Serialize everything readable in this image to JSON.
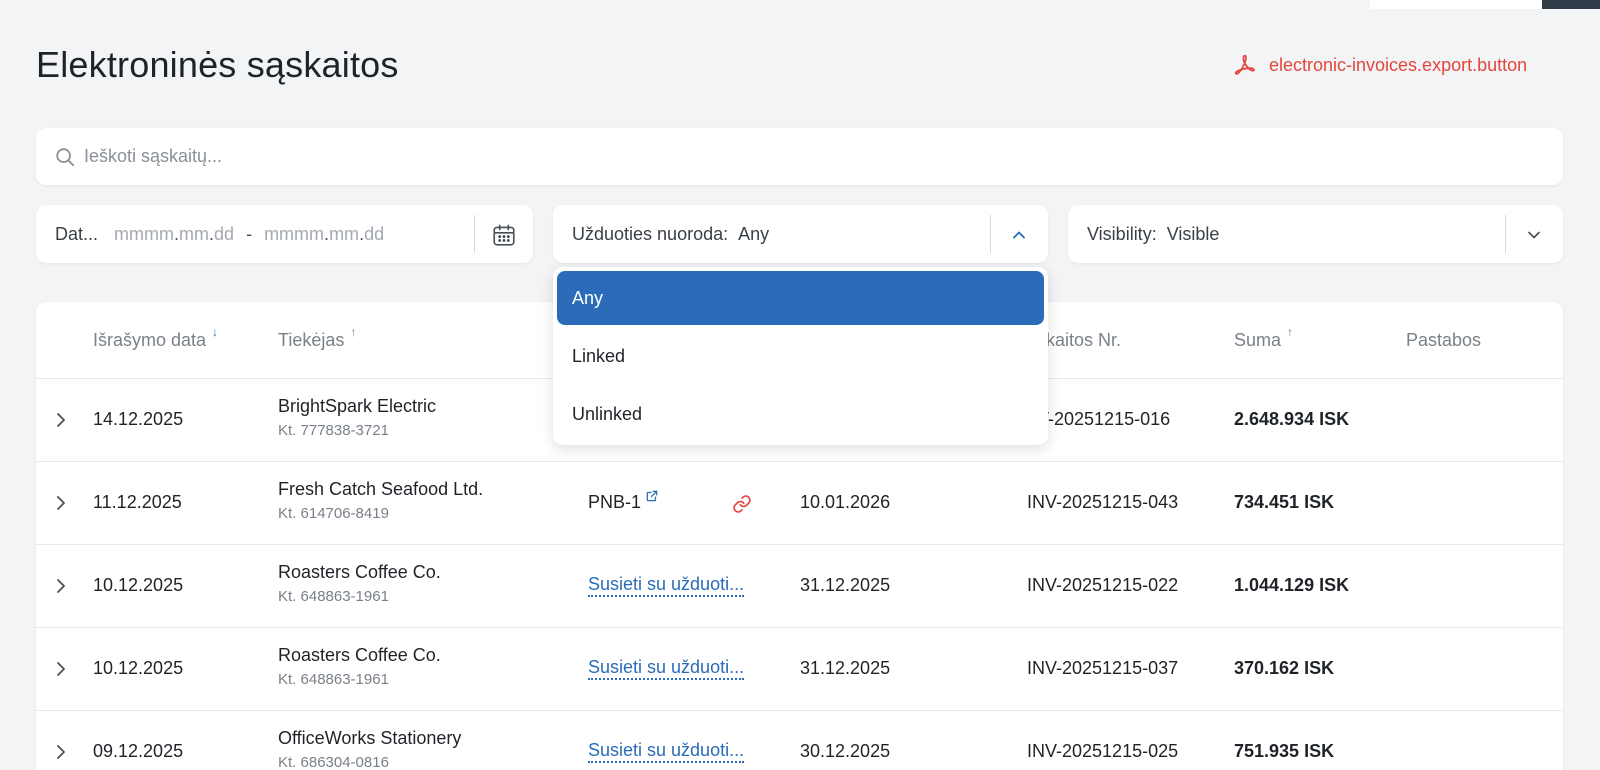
{
  "page": {
    "title": "Elektroninės sąskaitos",
    "export_label": "electronic-invoices.export.button"
  },
  "search": {
    "placeholder": "Ieškoti sąskaitų..."
  },
  "filters": {
    "date": {
      "label": "Dat...",
      "from_placeholder_parts": [
        "mmmm",
        "mm",
        "dd"
      ],
      "to_placeholder_parts": [
        "mmmm",
        "mm",
        "dd"
      ],
      "separator": "-"
    },
    "task_link": {
      "label": "Užduoties nuoroda:",
      "value": "Any",
      "open": true,
      "options": [
        "Any",
        "Linked",
        "Unlinked"
      ],
      "selected_index": 0
    },
    "visibility": {
      "label": "Visibility:",
      "value": "Visible"
    }
  },
  "table": {
    "columns": {
      "issue_date": "Išrašymo data",
      "supplier": "Tiekėjas",
      "invoice_no": "skaitos Nr.",
      "amount": "Suma",
      "notes": "Pastabos"
    },
    "rows": [
      {
        "issue_date": "14.12.2025",
        "supplier": "BrightSpark Electric",
        "supplier_code": "Kt. 777838-3721",
        "task": "",
        "due_date": "",
        "invoice_no": "V-20251215-016",
        "amount": "2.648.934 ISK"
      },
      {
        "issue_date": "11.12.2025",
        "supplier": "Fresh Catch Seafood Ltd.",
        "supplier_code": "Kt. 614706-8419",
        "task": "PNB-1",
        "due_date": "10.01.2026",
        "invoice_no": "INV-20251215-043",
        "amount": "734.451 ISK"
      },
      {
        "issue_date": "10.12.2025",
        "supplier": "Roasters Coffee Co.",
        "supplier_code": "Kt. 648863-1961",
        "task_link": "Susieti su užduoti...",
        "due_date": "31.12.2025",
        "invoice_no": "INV-20251215-022",
        "amount": "1.044.129 ISK"
      },
      {
        "issue_date": "10.12.2025",
        "supplier": "Roasters Coffee Co.",
        "supplier_code": "Kt. 648863-1961",
        "task_link": "Susieti su užduoti...",
        "due_date": "31.12.2025",
        "invoice_no": "INV-20251215-037",
        "amount": "370.162 ISK"
      },
      {
        "issue_date": "09.12.2025",
        "supplier": "OfficeWorks Stationery",
        "supplier_code": "Kt. 686304-0816",
        "task_link": "Susieti su užduoti...",
        "due_date": "30.12.2025",
        "invoice_no": "INV-20251215-025",
        "amount": "751.935 ISK"
      }
    ]
  },
  "colors": {
    "accent": "#2a6cb8",
    "export": "#e4463c",
    "background": "#f3f4f6"
  }
}
